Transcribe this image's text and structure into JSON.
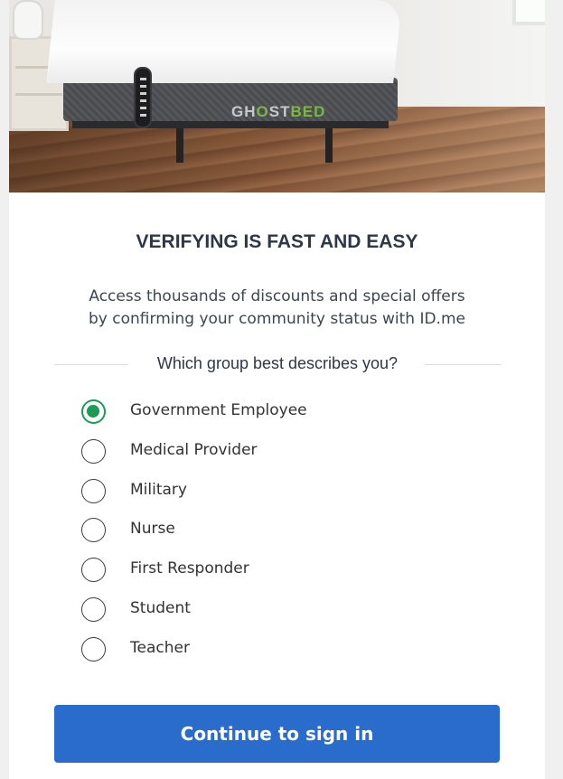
{
  "hero": {
    "brand_prefix": "GH",
    "brand_mid": "O",
    "brand_rest": "ST",
    "brand_accent": "BED",
    "accent_color": "#78b843"
  },
  "heading": "VERIFYING IS FAST AND EASY",
  "description_line1": "Access thousands of discounts and special offers",
  "description_line2": "by confirming your community status with ID.me",
  "question": "Which group best describes you?",
  "options": [
    {
      "label": "Government Employee",
      "selected": true
    },
    {
      "label": "Medical Provider",
      "selected": false
    },
    {
      "label": "Military",
      "selected": false
    },
    {
      "label": "Nurse",
      "selected": false
    },
    {
      "label": "First Responder",
      "selected": false
    },
    {
      "label": "Student",
      "selected": false
    },
    {
      "label": "Teacher",
      "selected": false
    }
  ],
  "continue_label": "Continue to sign in",
  "colors": {
    "primary_button": "#2a6ccc",
    "selected_radio": "#1c9a56",
    "heading_text": "#2d3748"
  }
}
